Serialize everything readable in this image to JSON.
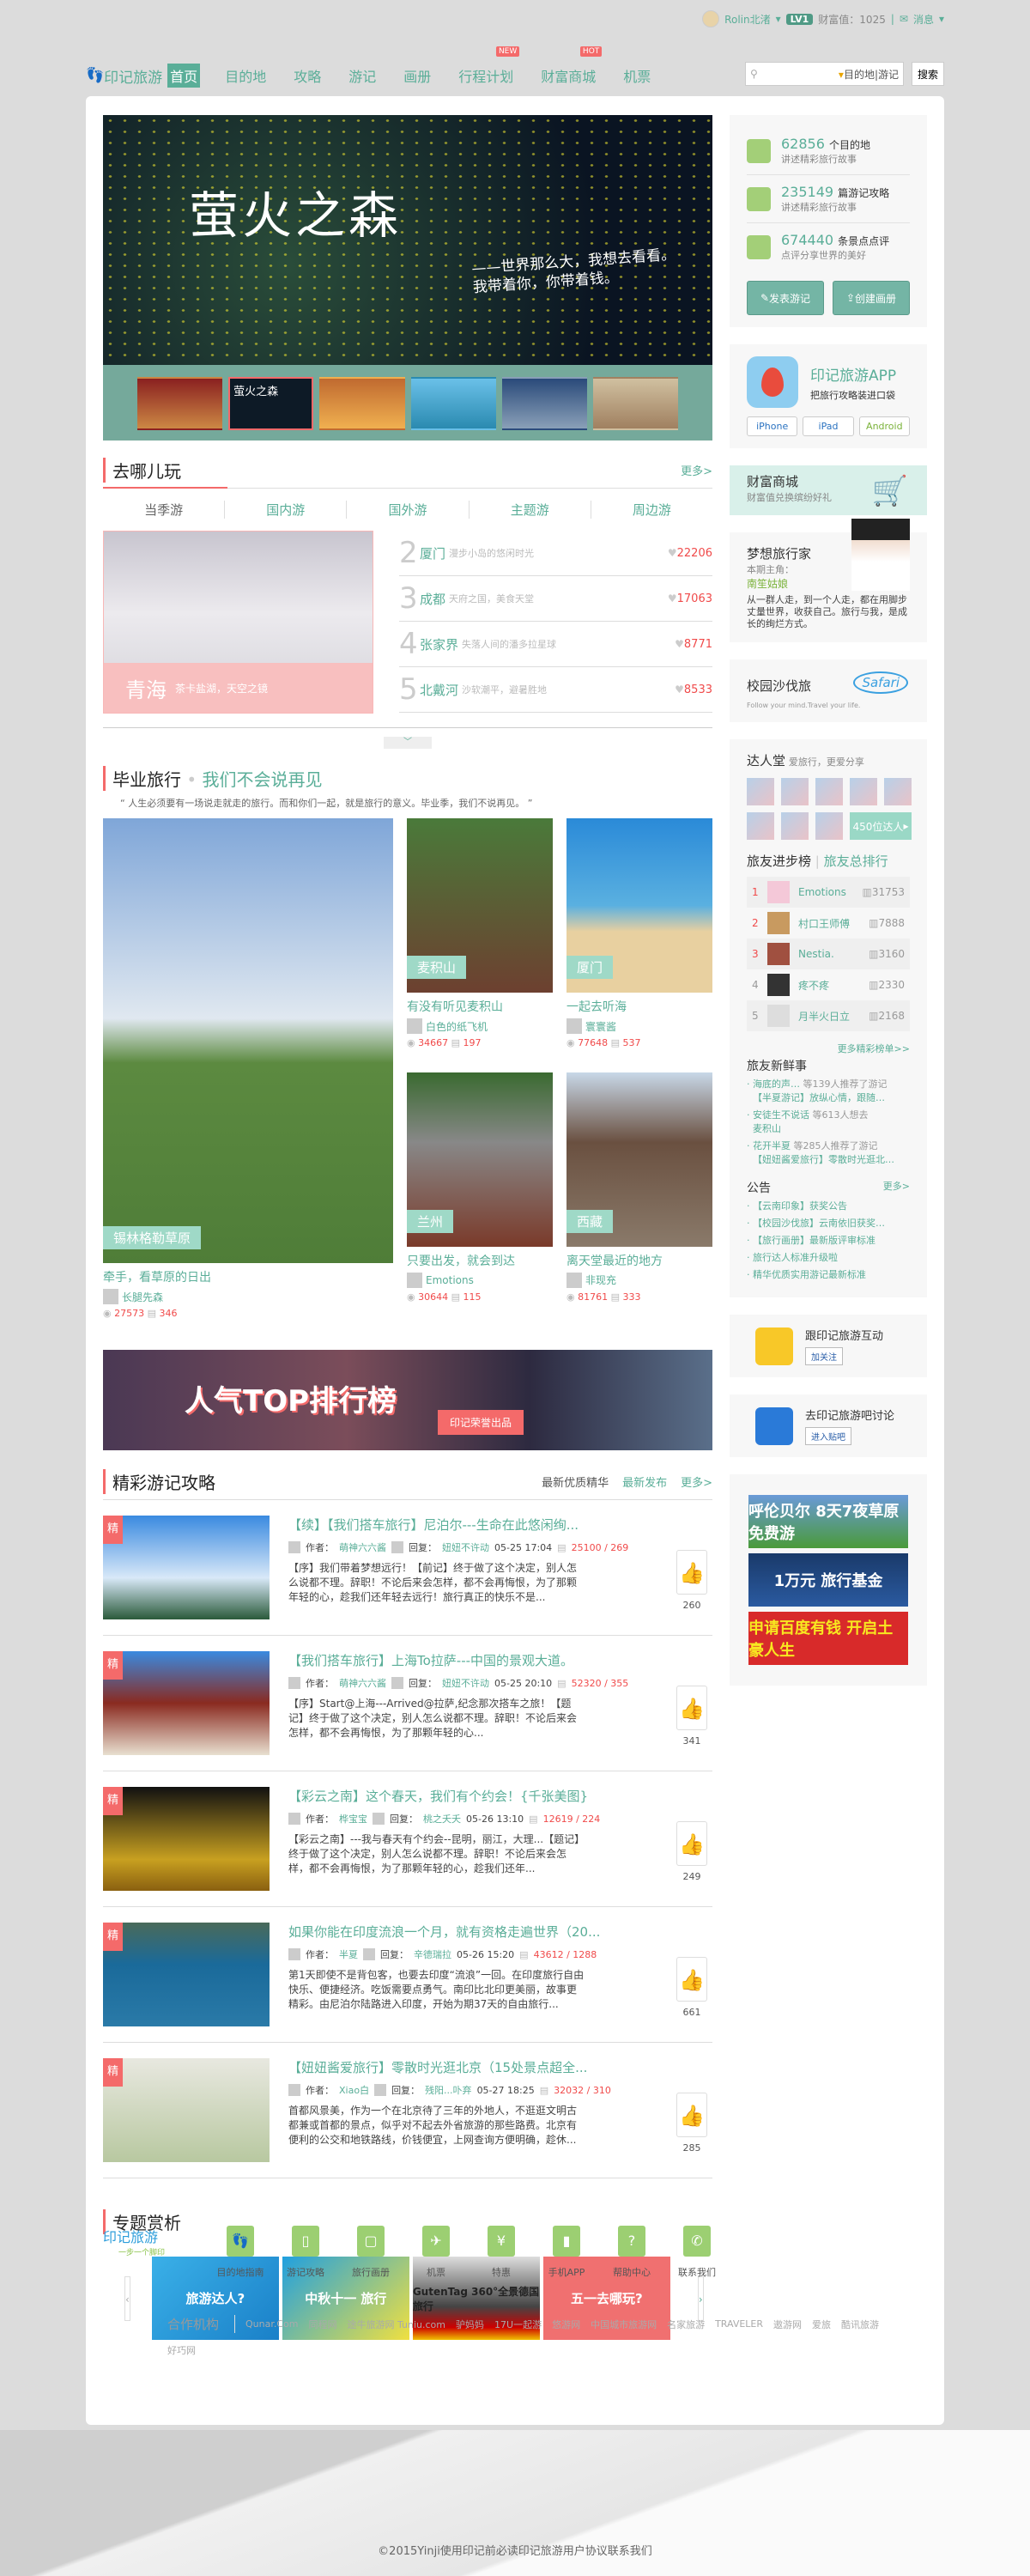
{
  "topbar": {
    "username": "Rolin北渚",
    "level": "LV1",
    "wealth": "财富值：1025",
    "messages": "消息"
  },
  "nav": {
    "logo": "印记旅游",
    "items": [
      {
        "label": "首页"
      },
      {
        "label": "目的地"
      },
      {
        "label": "攻略"
      },
      {
        "label": "游记"
      },
      {
        "label": "画册"
      },
      {
        "label": "行程计划",
        "badge": "NEW"
      },
      {
        "label": "财富商城",
        "badge": "HOT"
      },
      {
        "label": "机票"
      }
    ],
    "search_scope": "目的地|游记",
    "search_button": "搜索"
  },
  "hero": {
    "title": "萤火之森",
    "subtitle1": "——世界那么大，我想去看看。",
    "subtitle2": "我带着你，你带着钱。",
    "thumb_caption": "萤火之森"
  },
  "stats": [
    {
      "num": "62856",
      "unit": "个目的地",
      "sub": "讲述精彩旅行故事"
    },
    {
      "num": "235149",
      "unit": "篇游记攻略",
      "sub": "讲述精彩旅行故事"
    },
    {
      "num": "674440",
      "unit": "条景点点评",
      "sub": "点评分享世界的美好"
    }
  ],
  "actions": {
    "post": "发表游记",
    "album": "创建画册"
  },
  "app": {
    "title": "印记旅游APP",
    "sub": "把旅行攻略装进口袋",
    "iphone": "iPhone",
    "ipad": "iPad",
    "android": "Android"
  },
  "shop": {
    "title": "财富商城",
    "sub": "财富值兑换缤纷好礼"
  },
  "dream": {
    "title": "梦想旅行家",
    "label": "本期主角：",
    "name": "南笙姑娘",
    "desc": "从一群人走，到一个人走，都在用脚步丈量世界，收获自己。旅行与我，是成长的绚烂方式。"
  },
  "safari": {
    "title": "校园沙伐旅",
    "logo": "Safari",
    "motto": "Follow your mind.Travel your life."
  },
  "darren": {
    "title": "达人堂",
    "sub": "爱旅行，更爱分享",
    "count": "450位达人"
  },
  "leaderboard": {
    "tab1": "旅友进步榜",
    "tab2": "旅友总排行",
    "rows": [
      {
        "rank": "1",
        "name": "Emotions",
        "value": "31753"
      },
      {
        "rank": "2",
        "name": "村口王师傅",
        "value": "7888"
      },
      {
        "rank": "3",
        "name": "Nestia.",
        "value": "3160"
      },
      {
        "rank": "4",
        "name": "疼不疼",
        "value": "2330"
      },
      {
        "rank": "5",
        "name": "月半火日立",
        "value": "2168"
      }
    ],
    "more": "更多精彩榜单>>"
  },
  "feed": {
    "title": "旅友新鲜事",
    "items": [
      {
        "user": "海底的声…",
        "action": "等139人推荐了游记",
        "target": "【半夏游记】放纵心情，跟随…"
      },
      {
        "user": "安徒生不说话",
        "action": "等613人想去",
        "target": "麦积山"
      },
      {
        "user": "花开半夏",
        "action": "等285人推荐了游记",
        "target": "【妞妞酱爱旅行】零散时光逛北…"
      }
    ]
  },
  "notice": {
    "title": "公告",
    "more": "更多>",
    "items": [
      "【云南印象】获奖公告",
      "【校园沙伐旅】云南依旧获奖…",
      "【旅行画册】最新版评审标准",
      "旅行达人标准升级啦",
      "精华优质实用游记最新标准"
    ]
  },
  "weibo": {
    "text": "跟印记旅游互动",
    "button": "加关注"
  },
  "tieba": {
    "text": "去印记旅游吧讨论",
    "button": "进入贴吧"
  },
  "ads": [
    {
      "text": "呼伦贝尔 8天7夜草原免费游"
    },
    {
      "text": "1万元 旅行基金"
    },
    {
      "text": "申请百度有钱 开启土豪人生"
    }
  ],
  "where": {
    "title": "去哪儿玩",
    "more": "更多>",
    "tabs": [
      "当季游",
      "国内游",
      "国外游",
      "主题游",
      "周边游"
    ],
    "feature": {
      "city": "青海",
      "desc": "茶卡盐湖，天空之镜"
    },
    "ranks": [
      {
        "n": "2",
        "city": "厦门",
        "desc": "漫步小岛的悠闲时光",
        "hearts": "22206"
      },
      {
        "n": "3",
        "city": "成都",
        "desc": "天府之国，美食天堂",
        "hearts": "17063"
      },
      {
        "n": "4",
        "city": "张家界",
        "desc": "失落人间的潘多拉星球",
        "hearts": "8771"
      },
      {
        "n": "5",
        "city": "北戴河",
        "desc": "沙软潮平，避暑胜地",
        "hearts": "8533"
      }
    ]
  },
  "grad": {
    "title": "毕业旅行",
    "subtitle": "我们不会说再见",
    "quote": "“ 人生必须要有一场说走就走的旅行。而和你们一起，就是旅行的意义。毕业季，我们不说再见。 ”",
    "cards": [
      {
        "tag": "锡林格勒草原",
        "title": "牵手，看草原的日出",
        "author": "长腿先森",
        "views": "27573",
        "comments": "346"
      },
      {
        "tag": "麦积山",
        "title": "有没有听见麦积山",
        "author": "白色的纸飞机",
        "views": "34667",
        "comments": "197"
      },
      {
        "tag": "厦门",
        "title": "一起去听海",
        "author": "寰寰酱",
        "views": "77648",
        "comments": "537"
      },
      {
        "tag": "兰州",
        "title": "只要出发，就会到达",
        "author": "Emotions",
        "views": "30644",
        "comments": "115"
      },
      {
        "tag": "西藏",
        "title": "离天堂最近的地方",
        "author": "非现充",
        "views": "81761",
        "comments": "333"
      }
    ]
  },
  "promo": {
    "title": "人气TOP排行榜",
    "button": "印记荣誉出品"
  },
  "articles": {
    "title": "精彩游记攻略",
    "tabs": [
      "最新优质精华",
      "最新发布",
      "更多>"
    ],
    "badge": "精",
    "author_label": "作者：",
    "reply_label": "回复：",
    "items": [
      {
        "title": "【续】【我们搭车旅行】尼泊尔---生命在此悠闲绚...",
        "author": "萌神六六酱",
        "reply": "妞妞不许动",
        "time": "05-25 17:04",
        "views": "25100",
        "comments": "269",
        "excerpt": "【序】我们带着梦想远行！【前记】终于做了这个决定，别人怎么说都不理。辞职！不论后来会怎样，都不会再悔恨，为了那颗年轻的心，趁我们还年轻去远行！旅行真正的快乐不是...",
        "likes": "260"
      },
      {
        "title": "【我们搭车旅行】上海To拉萨---中国的景观大道。",
        "author": "萌神六六酱",
        "reply": "妞妞不许动",
        "time": "05-25 20:10",
        "views": "52320",
        "comments": "355",
        "excerpt": "【序】Start@上海---Arrived@拉萨,纪念那次搭车之旅！【题记】终于做了这个决定，别人怎么说都不理。辞职！不论后来会怎样，都不会再悔恨，为了那颗年轻的心...",
        "likes": "341"
      },
      {
        "title": "【彩云之南】这个春天，我们有个约会！{千张美图}",
        "author": "桦宝宝",
        "reply": "桃之夭夭",
        "time": "05-26 13:10",
        "views": "12619",
        "comments": "224",
        "excerpt": "【彩云之南】---我与春天有个约会--昆明，丽江，大理...【题记】终于做了这个决定，别人怎么说都不理。辞职！不论后来会怎样，都不会再悔恨，为了那颗年轻的心，趁我们还年...",
        "likes": "249"
      },
      {
        "title": "如果你能在印度流浪一个月，就有资格走遍世界（20...",
        "author": "半夏",
        "reply": "辛德瑞拉",
        "time": "05-26 15:20",
        "views": "43612",
        "comments": "1288",
        "excerpt": "第1天即使不是背包客，也要去印度“流浪”一回。在印度旅行自由快乐、便捷经济。吃饭需要点勇气。南印比北印更美丽，故事更精彩。由尼泊尔陆路进入印度，开始为期37天的自由旅行...",
        "likes": "661"
      },
      {
        "title": "【妞妞酱爱旅行】零散时光逛北京（15处景点超全...",
        "author": "Xiao白",
        "reply": "残阳...卟弃",
        "time": "05-27 18:25",
        "views": "32032",
        "comments": "310",
        "excerpt": "首都风景美，作为一个在北京待了三年的外地人，不逛逛文明古都兼或首都的景点，似乎对不起去外省旅游的那些路费。北京有便利的公交和地铁路线，价钱便宜，上网查询方便明确，趁休...",
        "likes": "285"
      }
    ]
  },
  "topics": {
    "title": "专题赏析",
    "slides": [
      "旅游达人?",
      "中秋十一 旅行",
      "GutenTag 360°全景德国旅行",
      "五一去哪玩?"
    ]
  },
  "footer": {
    "logo": "印记旅游",
    "slogan": "一步一个脚印",
    "links": [
      "目的地指南",
      "游记攻略",
      "旅行画册",
      "机票",
      "特惠",
      "手机APP",
      "帮助中心",
      "联系我们"
    ],
    "partners_label": "合作机构",
    "partners": [
      "Qunar.Com",
      "同程网",
      "途牛旅游网 Tuniu.com",
      "驴妈妈",
      "17U一起游",
      "悠游网",
      "中国城市旅游网",
      "名家旅游",
      "TRAVELER",
      "遨游网",
      "爱旅",
      "酷讯旅游",
      "好巧网"
    ],
    "copyright": "©2015Yinji使用印记前必读印记旅游用户协议联系我们"
  },
  "colors": {
    "accent": "#5aae98",
    "red": "#f46a6a",
    "bg": "#dcdcdc"
  }
}
